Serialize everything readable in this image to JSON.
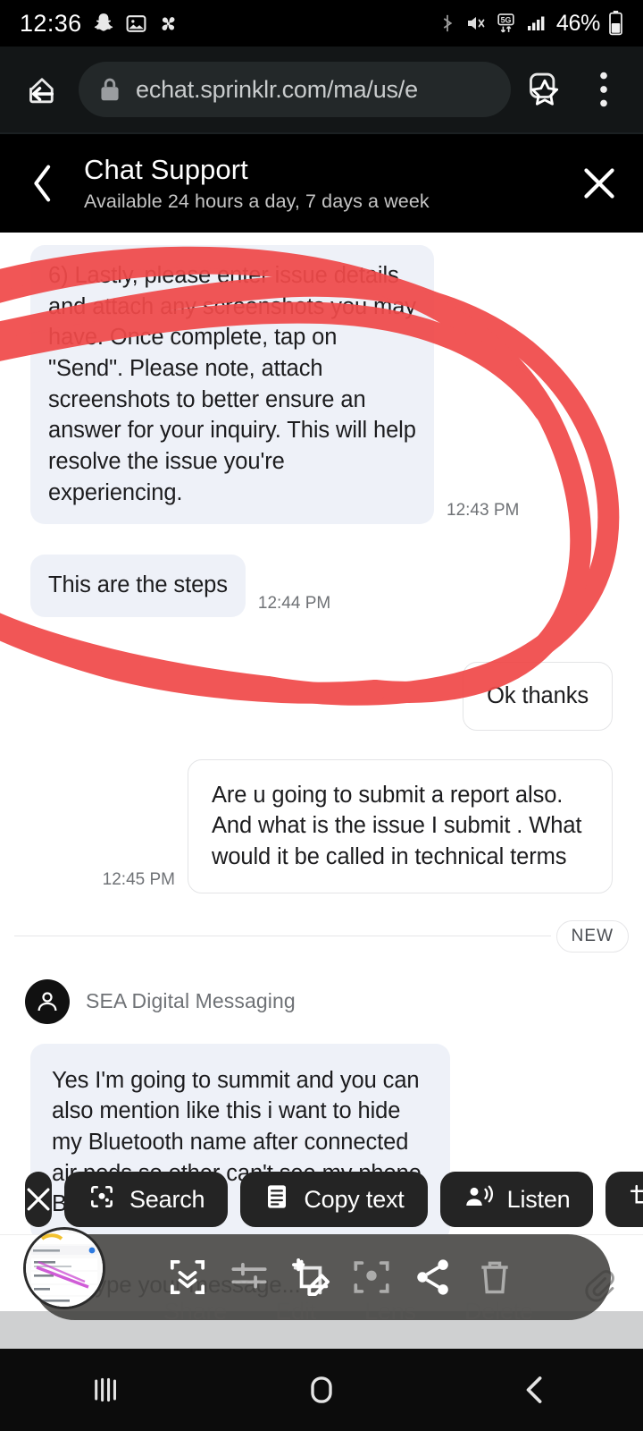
{
  "status_bar": {
    "clock": "12:36",
    "battery_percent": "46%",
    "icons": [
      "snapchat-icon",
      "photos-icon",
      "pinwheel-icon",
      "bluetooth-icon",
      "mute-icon",
      "5g-icon",
      "signal-icon",
      "battery-icon"
    ],
    "network_label": "5G"
  },
  "browser": {
    "url": "echat.sprinklr.com/ma/us/e",
    "lock_icon": "lock-icon",
    "home_back_icon": "home-back-icon",
    "bookmark_icon": "bookmark-star-icon",
    "overflow_icon": "overflow-menu-icon"
  },
  "chat_header": {
    "back_icon": "chevron-left-icon",
    "title": "Chat Support",
    "subtitle": "Available 24 hours a day, 7 days a week",
    "close_icon": "close-icon"
  },
  "conversation": {
    "messages": [
      {
        "side": "in",
        "text": "6) Lastly, please enter issue details and attach any screenshots you may have. Once complete, tap on \"Send\". Please note, attach screenshots to better ensure an answer for your inquiry. This will help resolve the issue you're experiencing.",
        "time": "12:43 PM"
      },
      {
        "side": "in",
        "text": "This are the steps",
        "time": "12:44 PM"
      },
      {
        "side": "out",
        "text": "Ok thanks",
        "time": ""
      },
      {
        "side": "out",
        "text": "Are u going to submit a report also. And what is the issue I submit . What would it be called in technical terms",
        "time": "12:45 PM"
      }
    ],
    "new_divider_label": "NEW",
    "agent": {
      "name": "SEA Digital Messaging",
      "avatar_icon": "person-avatar-icon"
    },
    "latest_message": {
      "side": "in",
      "text": "Yes I'm going to summit and you can also mention like this i want to hide my Bluetooth name after connected air pods so other can't see my phone Bluetooth name"
    }
  },
  "composer": {
    "placeholder": "Type your message...",
    "emoji_icon": "emoji-icon",
    "attach_icon": "paperclip-icon"
  },
  "selection_toolbar": {
    "items": [
      {
        "label": "",
        "icon": "close-icon",
        "icon_only": true
      },
      {
        "label": "Search",
        "icon": "lens-search-icon",
        "icon_only": false
      },
      {
        "label": "Copy text",
        "icon": "copy-text-icon",
        "icon_only": false
      },
      {
        "label": "Listen",
        "icon": "listen-icon",
        "icon_only": false
      },
      {
        "label": "Cr",
        "icon": "crop-icon",
        "icon_only": false
      }
    ]
  },
  "screenshot_toolbar": {
    "items": [
      {
        "label": "Share",
        "icon": "share-icon"
      },
      {
        "label": "Edit",
        "icon": "edit-pencil-icon"
      },
      {
        "label": "Lens",
        "icon": "lens-icon"
      },
      {
        "label": "Delete",
        "icon": "trash-icon"
      }
    ],
    "capsule_icons": [
      "scroll-capture-icon",
      "crop-adjust-icon",
      "edit-crop-icon",
      "lens-scan-icon",
      "share-node-icon",
      "trash-icon"
    ],
    "thumbnail_name": "screenshot-thumbnail"
  },
  "nav_bar": {
    "recents_icon": "recents-icon",
    "home_icon": "home-icon",
    "back_icon": "back-icon"
  },
  "colors": {
    "accent_red": "#f04a4a",
    "bubble_in": "#eef1f8",
    "bubble_out_border": "#e3e4e6",
    "header_bg": "#000000",
    "browser_bg": "#131617"
  }
}
